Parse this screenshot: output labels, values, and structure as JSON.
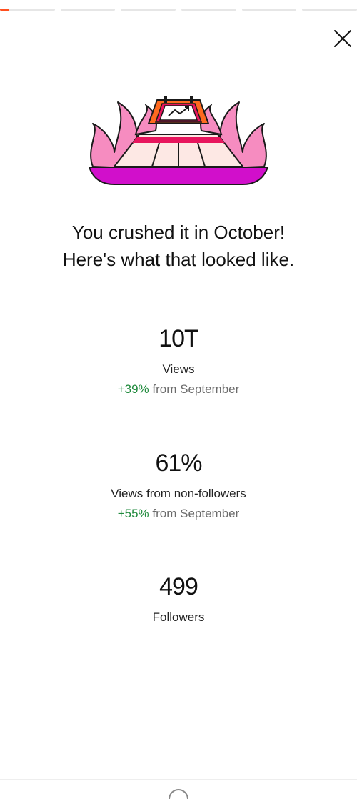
{
  "progress": {
    "segments": 6,
    "active_index": 0,
    "accent_color": "#ff4f1f"
  },
  "close": {
    "icon": "close-icon"
  },
  "hero": {
    "icon": "trending-up-chart-illustration"
  },
  "headline": {
    "line1": "You crushed it in October!",
    "line2": "Here's what that looked like."
  },
  "stats": [
    {
      "value": "10T",
      "label": "Views",
      "change_pct": "+39%",
      "change_suffix": " from September"
    },
    {
      "value": "61%",
      "label": "Views from non-followers",
      "change_pct": "+55%",
      "change_suffix": " from September"
    },
    {
      "value": "499",
      "label": "Followers"
    }
  ],
  "colors": {
    "positive": "#1f8a3c",
    "muted": "#6b6b6b"
  }
}
